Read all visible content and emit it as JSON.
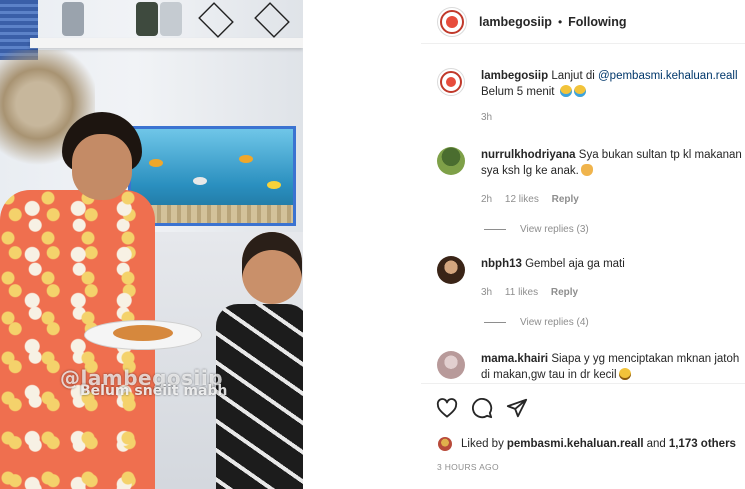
{
  "media": {
    "watermark": "@lambegosiip",
    "overlay_caption": "Belum sneiit mabh"
  },
  "header": {
    "username": "lambegosiip",
    "separator": "•",
    "follow_status": "Following"
  },
  "caption": {
    "username": "lambegosiip",
    "text_before": "Lanjut di ",
    "mention": "@pembasmi.kehaluan.reall",
    "line2": "Belum 5 menit",
    "emoji": [
      "crying-face",
      "crying-face"
    ],
    "time": "3h"
  },
  "comments": [
    {
      "username": "nurrulkhodriyana",
      "line1": "Sya bukan sultan tp kl makanan",
      "line2": "sya ksh lg ke anak.",
      "emoji": "clapping-hands",
      "time": "2h",
      "likes": "12 likes",
      "reply_label": "Reply",
      "view_replies": "View replies (3)"
    },
    {
      "username": "nbph13",
      "line1": "Gembel aja ga mati",
      "time": "3h",
      "likes": "11 likes",
      "reply_label": "Reply",
      "view_replies": "View replies (4)"
    },
    {
      "username": "mama.khairi",
      "line1": "Siapa y yg menciptakan mknan jatoh",
      "line2": "di makan,gw tau in dr kecil",
      "emoji": "tired-face"
    }
  ],
  "actions": {
    "icons": [
      "heart-icon",
      "comment-icon",
      "share-icon"
    ]
  },
  "likes": {
    "prefix": "Liked by",
    "user": "pembasmi.kehaluan.reall",
    "middle": "and",
    "others": "1,173 others"
  },
  "timestamp": "3 HOURS AGO",
  "colors": {
    "text": "#262626",
    "muted": "#8e8e8e",
    "mention": "#00376b",
    "border": "#efefef"
  }
}
